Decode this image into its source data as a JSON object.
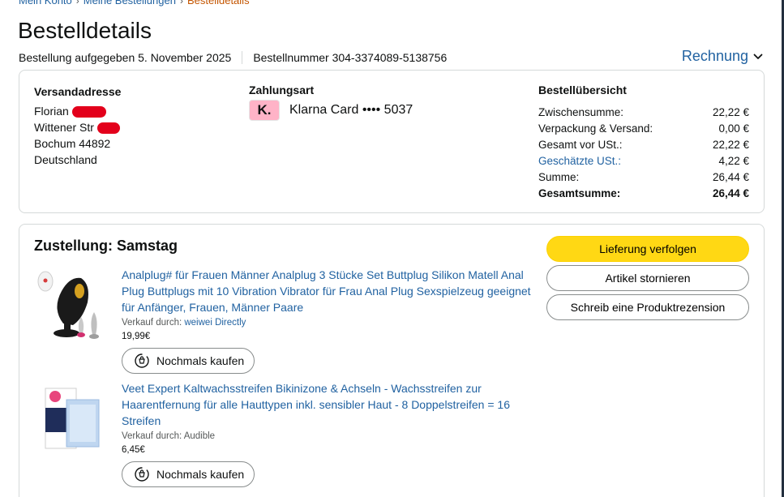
{
  "breadcrumb": {
    "items": [
      "Mein Konto",
      "Meine Bestellungen"
    ],
    "current": "Bestelldetails"
  },
  "page_title": "Bestelldetails",
  "order_meta": {
    "placed": "Bestellung aufgegeben 5. November 2025",
    "number": "Bestellnummer 304-3374089-5138756"
  },
  "invoice_label": "Rechnung",
  "shipping": {
    "label": "Versandadresse",
    "name": "Florian",
    "street": "Wittener Str",
    "city": "Bochum 44892",
    "country": "Deutschland"
  },
  "payment": {
    "label": "Zahlungsart",
    "logo_letter": "K.",
    "card": "Klarna Card •••• 5037"
  },
  "summary": {
    "label": "Bestellübersicht",
    "rows": [
      {
        "label": "Zwischensumme:",
        "value": "22,22 €"
      },
      {
        "label": "Verpackung & Versand:",
        "value": "0,00 €"
      },
      {
        "label": "Gesamt vor USt.:",
        "value": "22,22 €"
      },
      {
        "label": "Geschätzte USt.:",
        "value": "4,22 €"
      },
      {
        "label": "Summe:",
        "value": "26,44 €"
      },
      {
        "label": "Gesamtsumme:",
        "value": "26,44 €"
      }
    ]
  },
  "delivery": {
    "title": "Zustellung: Samstag",
    "buttons": {
      "track": "Lieferung verfolgen",
      "cancel": "Artikel stornieren",
      "review": "Schreib eine Produktrezension"
    },
    "items": [
      {
        "title": "Analplug# für Frauen Männer Analplug 3 Stücke Set Buttplug Silikon Matell Anal Plug Buttplugs mit 10 Vibration Vibrator für Frau Anal Plug Sexspielzeug geeignet für Anfänger, Frauen, Männer Paare",
        "seller_prefix": "Verkauf durch:",
        "seller": "weiwei Directly",
        "price": "19,99€",
        "rebuy": "Nochmals kaufen"
      },
      {
        "title": "Veet Expert Kaltwachsstreifen Bikinizone & Achseln - Wachsstreifen zur Haarentfernung für alle Hauttypen inkl. sensibler Haut - 8 Doppelstreifen = 16 Streifen",
        "seller_prefix": "Verkauf durch:",
        "seller": "Audible",
        "price": "6,45€",
        "rebuy": "Nochmals kaufen"
      }
    ]
  },
  "colors": {
    "link": "#2162a1",
    "breadcrumb_current": "#c45500",
    "primary_button": "#ffd814",
    "redaction": "#e3001b",
    "klarna_pink": "#ffb3c7"
  },
  "icons": [
    "chevron-down-icon",
    "rebuy-cart-icon",
    "klarna-logo"
  ]
}
